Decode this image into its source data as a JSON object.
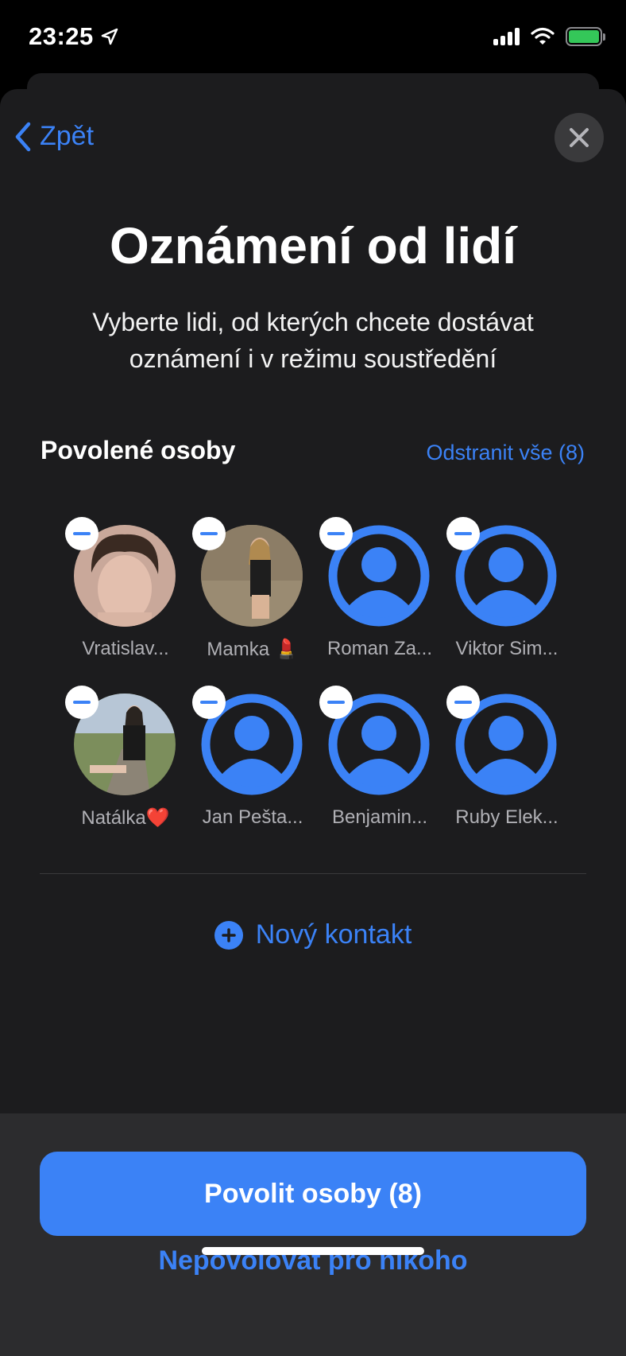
{
  "status_bar": {
    "time": "23:25",
    "icons": [
      "location-arrow-icon",
      "cellular-signal-icon",
      "wifi-icon",
      "battery-charging-icon"
    ]
  },
  "nav": {
    "back_label": "Zpět",
    "close_icon": "close-icon"
  },
  "header": {
    "title": "Oznámení od lidí",
    "subtitle": "Vyberte lidi, od kterých chcete dostávat oznámení i v režimu soustředění"
  },
  "allowed": {
    "section_label": "Povolené osoby",
    "remove_all_label": "Odstranit vše (8)",
    "people": [
      {
        "name": "Vratislav...",
        "avatar": "photo"
      },
      {
        "name": "Mamka 💄",
        "avatar": "photo"
      },
      {
        "name": "Roman Za...",
        "avatar": "placeholder"
      },
      {
        "name": "Viktor Sim...",
        "avatar": "placeholder"
      },
      {
        "name": "Natálka❤️",
        "avatar": "photo"
      },
      {
        "name": "Jan Pešta...",
        "avatar": "placeholder"
      },
      {
        "name": "Benjamin...",
        "avatar": "placeholder"
      },
      {
        "name": "Ruby Elek...",
        "avatar": "placeholder"
      }
    ]
  },
  "new_contact_label": "Nový kontakt",
  "footer": {
    "primary_label": "Povolit osoby (8)",
    "secondary_label": "Nepovolovat pro nikoho"
  },
  "colors": {
    "accent": "#3b82f6",
    "sheet_bg": "#1c1c1e",
    "footer_bg": "#2c2c2e"
  }
}
